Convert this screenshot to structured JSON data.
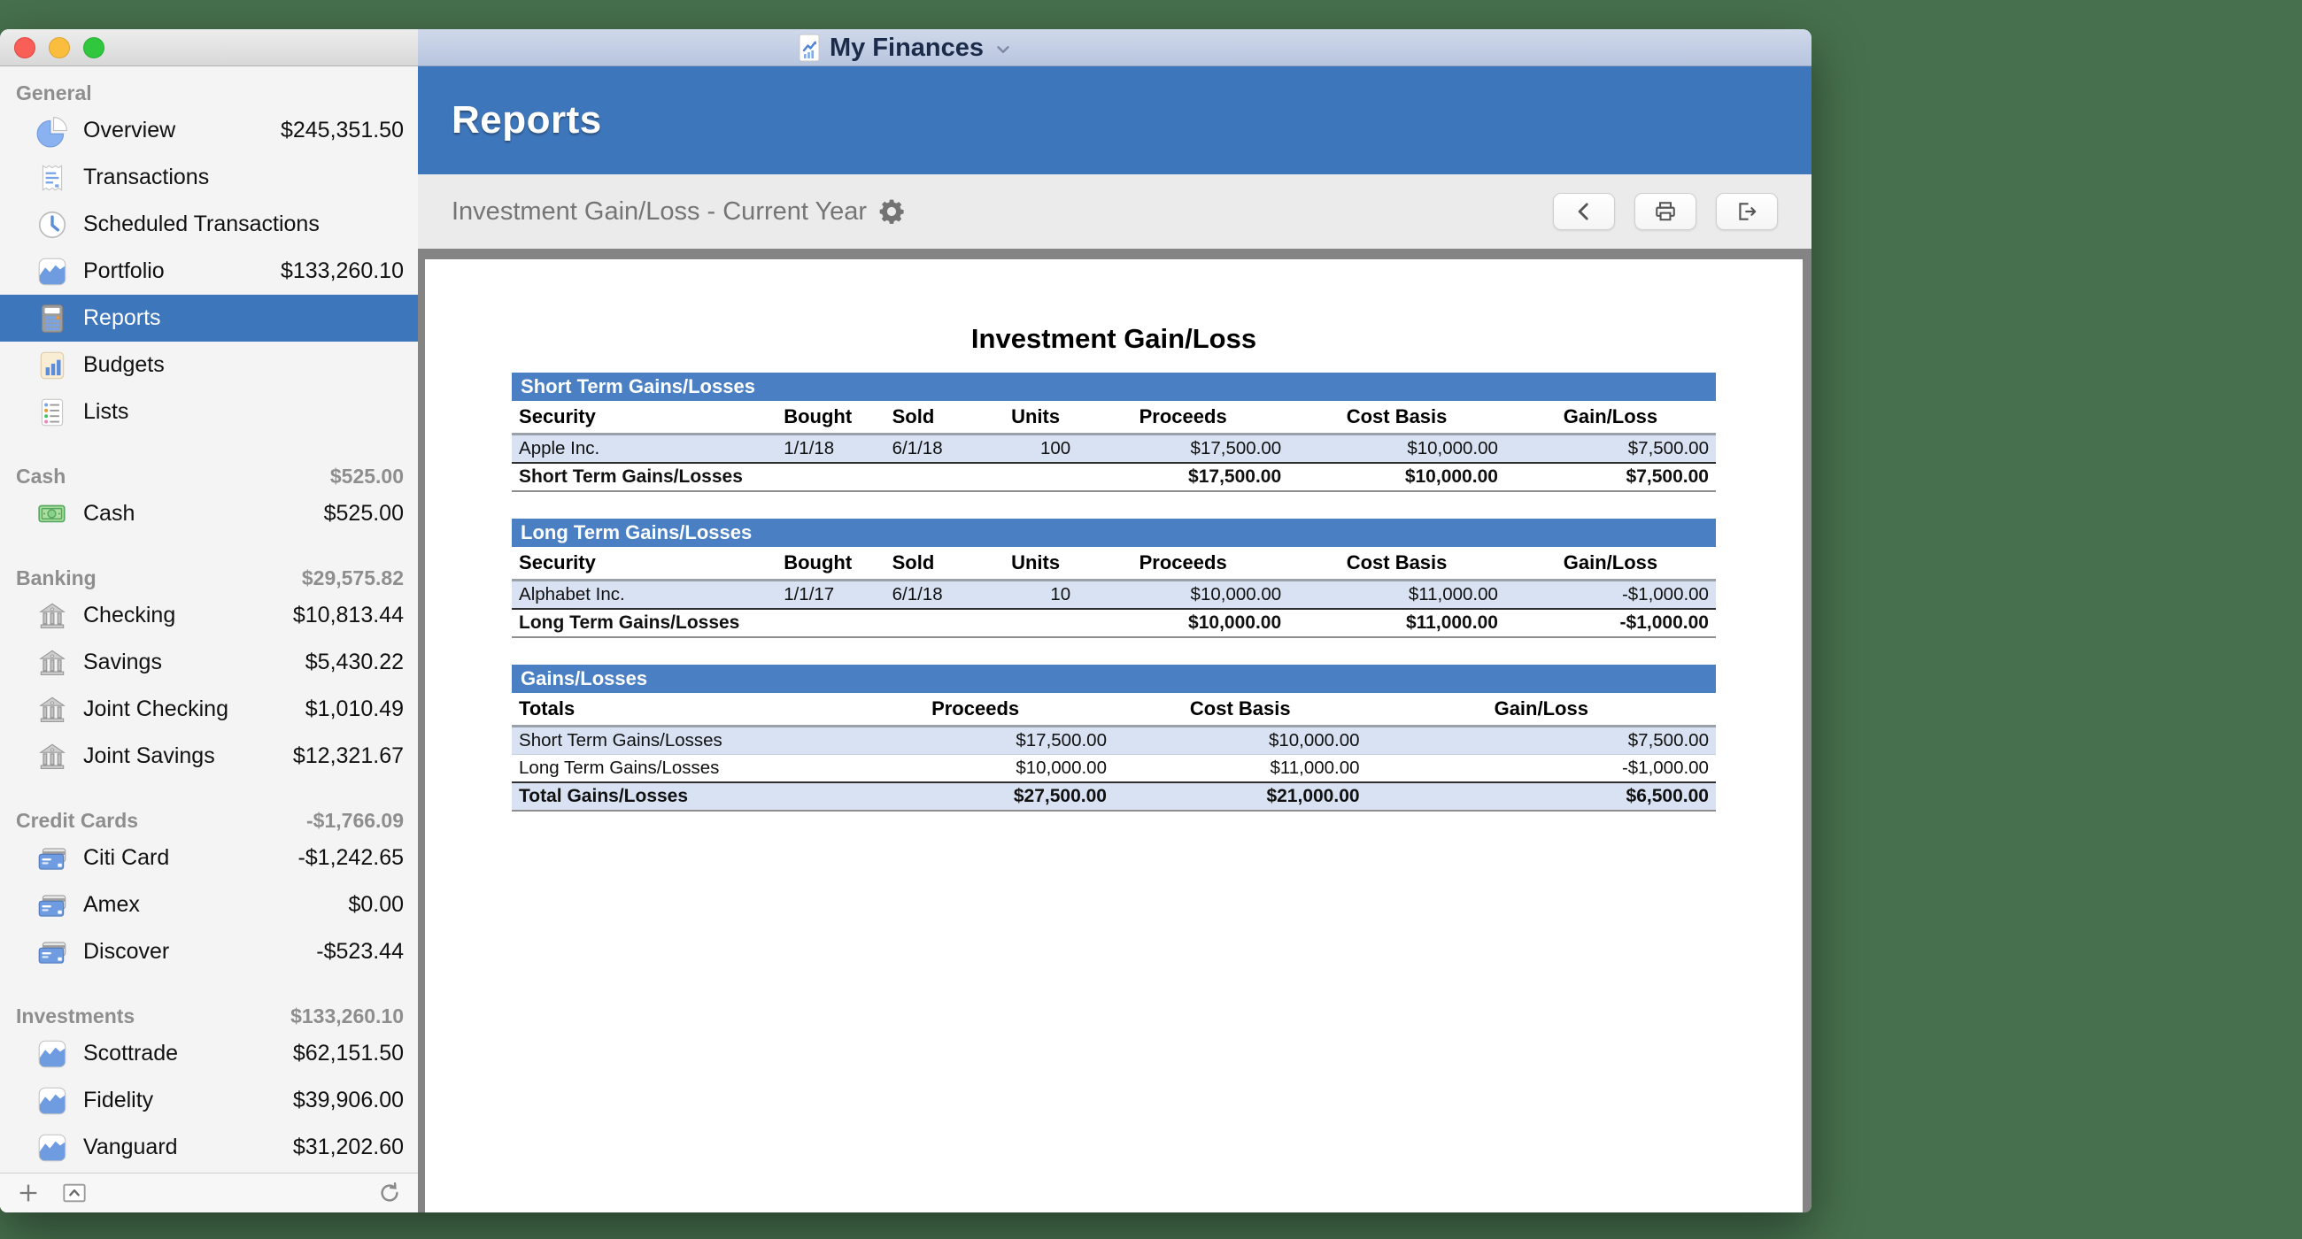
{
  "colors": {
    "desktop_background": "#47714e",
    "accent_blue": "#3e76bb",
    "table_header_blue": "#4a80c3",
    "row_shade_blue": "#d8e2f2",
    "selected_row_blue": "#3e76bb"
  },
  "window": {
    "title": "My Finances",
    "title_icon": "finance-document",
    "title_chevron": "chevron-down",
    "traffic_lights": [
      "close",
      "minimize",
      "zoom"
    ]
  },
  "sidebar": {
    "sections": [
      {
        "label": "General",
        "amount": "",
        "items": [
          {
            "icon": "pie-chart",
            "label": "Overview",
            "amount": "$245,351.50"
          },
          {
            "icon": "receipt",
            "label": "Transactions",
            "amount": ""
          },
          {
            "icon": "clock",
            "label": "Scheduled Transactions",
            "amount": ""
          },
          {
            "icon": "area-chart",
            "label": "Portfolio",
            "amount": "$133,260.10"
          },
          {
            "icon": "calculator",
            "label": "Reports",
            "amount": "",
            "selected": true
          },
          {
            "icon": "bar-chart",
            "label": "Budgets",
            "amount": ""
          },
          {
            "icon": "list",
            "label": "Lists",
            "amount": ""
          }
        ]
      },
      {
        "label": "Cash",
        "amount": "$525.00",
        "items": [
          {
            "icon": "cash",
            "label": "Cash",
            "amount": "$525.00"
          }
        ]
      },
      {
        "label": "Banking",
        "amount": "$29,575.82",
        "items": [
          {
            "icon": "bank",
            "label": "Checking",
            "amount": "$10,813.44"
          },
          {
            "icon": "bank",
            "label": "Savings",
            "amount": "$5,430.22"
          },
          {
            "icon": "bank",
            "label": "Joint Checking",
            "amount": "$1,010.49"
          },
          {
            "icon": "bank",
            "label": "Joint Savings",
            "amount": "$12,321.67"
          }
        ]
      },
      {
        "label": "Credit Cards",
        "amount": "-$1,766.09",
        "items": [
          {
            "icon": "credit-card",
            "label": "Citi Card",
            "amount": "-$1,242.65"
          },
          {
            "icon": "credit-card",
            "label": "Amex",
            "amount": "$0.00"
          },
          {
            "icon": "credit-card",
            "label": "Discover",
            "amount": "-$523.44"
          }
        ]
      },
      {
        "label": "Investments",
        "amount": "$133,260.10",
        "items": [
          {
            "icon": "area-chart",
            "label": "Scottrade",
            "amount": "$62,151.50"
          },
          {
            "icon": "area-chart",
            "label": "Fidelity",
            "amount": "$39,906.00"
          },
          {
            "icon": "area-chart",
            "label": "Vanguard",
            "amount": "$31,202.60"
          }
        ]
      }
    ],
    "bottombar_buttons": [
      {
        "icon": "plus"
      },
      {
        "icon": "expand"
      }
    ],
    "bottombar_right_button": {
      "icon": "refresh"
    }
  },
  "header": {
    "title": "Reports"
  },
  "toolbar": {
    "report_title": "Investment Gain/Loss - Current Year",
    "settings_icon": "gear",
    "buttons": [
      {
        "icon": "chevron-left"
      },
      {
        "icon": "printer"
      },
      {
        "icon": "export"
      }
    ]
  },
  "report": {
    "title": "Investment Gain/Loss",
    "tables": [
      {
        "caption": "Short Term Gains/Losses",
        "columns": [
          {
            "label": "Security",
            "width": "22%",
            "head_align": "left",
            "cell_align": "left"
          },
          {
            "label": "Bought",
            "width": "9%",
            "head_align": "left",
            "cell_align": "left"
          },
          {
            "label": "Sold",
            "width": "9%",
            "head_align": "left",
            "cell_align": "left"
          },
          {
            "label": "Units",
            "width": "7%",
            "head_align": "center",
            "cell_align": "right"
          },
          {
            "label": "Proceeds",
            "width": "17.5%",
            "head_align": "center",
            "cell_align": "right"
          },
          {
            "label": "Cost Basis",
            "width": "18%",
            "head_align": "center",
            "cell_align": "right"
          },
          {
            "label": "Gain/Loss",
            "width": "17.5%",
            "head_align": "center",
            "cell_align": "right"
          }
        ],
        "rows": [
          {
            "shade": true,
            "cells": [
              "Apple Inc.",
              "1/1/18",
              "6/1/18",
              "100",
              "$17,500.00",
              "$10,000.00",
              "$7,500.00"
            ]
          }
        ],
        "total": {
          "label": "Short Term Gains/Losses",
          "shade": false,
          "values": [
            "$17,500.00",
            "$10,000.00",
            "$7,500.00"
          ]
        }
      },
      {
        "caption": "Long Term Gains/Losses",
        "columns": [
          {
            "label": "Security",
            "width": "22%",
            "head_align": "left",
            "cell_align": "left"
          },
          {
            "label": "Bought",
            "width": "9%",
            "head_align": "left",
            "cell_align": "left"
          },
          {
            "label": "Sold",
            "width": "9%",
            "head_align": "left",
            "cell_align": "left"
          },
          {
            "label": "Units",
            "width": "7%",
            "head_align": "center",
            "cell_align": "right"
          },
          {
            "label": "Proceeds",
            "width": "17.5%",
            "head_align": "center",
            "cell_align": "right"
          },
          {
            "label": "Cost Basis",
            "width": "18%",
            "head_align": "center",
            "cell_align": "right"
          },
          {
            "label": "Gain/Loss",
            "width": "17.5%",
            "head_align": "center",
            "cell_align": "right"
          }
        ],
        "rows": [
          {
            "shade": true,
            "cells": [
              "Alphabet Inc.",
              "1/1/17",
              "6/1/18",
              "10",
              "$10,000.00",
              "$11,000.00",
              "-$1,000.00"
            ]
          }
        ],
        "total": {
          "label": "Long Term Gains/Losses",
          "shade": false,
          "values": [
            "$10,000.00",
            "$11,000.00",
            "-$1,000.00"
          ]
        }
      },
      {
        "caption": "Gains/Losses",
        "columns": [
          {
            "label": "Totals",
            "width": "27%",
            "head_align": "left",
            "cell_align": "left"
          },
          {
            "label": "Proceeds",
            "width": "23%",
            "head_align": "center",
            "cell_align": "right"
          },
          {
            "label": "Cost Basis",
            "width": "21%",
            "head_align": "center",
            "cell_align": "right"
          },
          {
            "label": "Gain/Loss",
            "width": "29%",
            "head_align": "center",
            "cell_align": "right"
          }
        ],
        "rows": [
          {
            "shade": true,
            "cells": [
              "Short Term Gains/Losses",
              "$17,500.00",
              "$10,000.00",
              "$7,500.00"
            ]
          },
          {
            "shade": false,
            "cells": [
              "Long Term Gains/Losses",
              "$10,000.00",
              "$11,000.00",
              "-$1,000.00"
            ]
          }
        ],
        "total": {
          "label": "Total Gains/Losses",
          "shade": true,
          "values": [
            "$27,500.00",
            "$21,000.00",
            "$6,500.00"
          ]
        }
      }
    ]
  }
}
